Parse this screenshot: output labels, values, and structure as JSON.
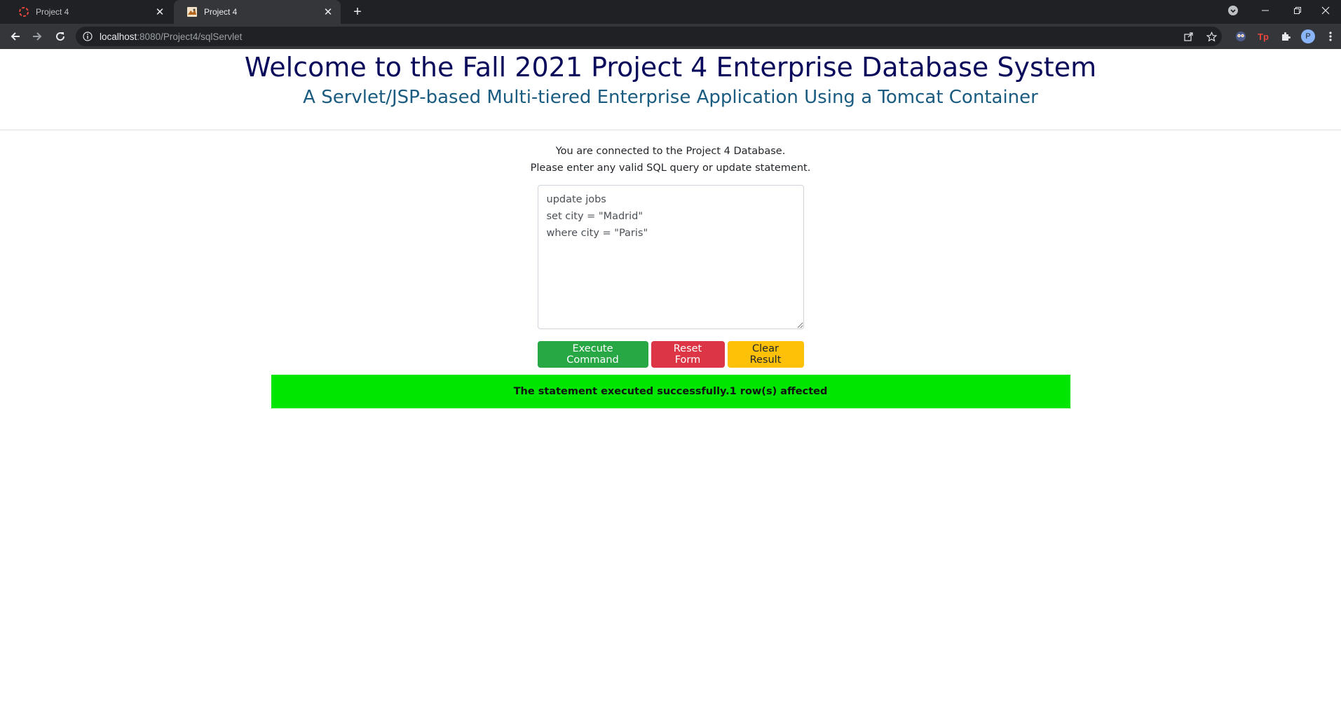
{
  "browser": {
    "tabs": [
      {
        "title": "Project 4",
        "active": false
      },
      {
        "title": "Project 4",
        "active": true
      }
    ],
    "url": {
      "host": "localhost",
      "path": ":8080/Project4/sqlServlet"
    },
    "profile_initial": "P",
    "extension_label": "Tp"
  },
  "page": {
    "title": "Welcome to the Fall 2021 Project 4 Enterprise Database System",
    "subtitle": "A Servlet/JSP-based Multi-tiered Enterprise Application Using a Tomcat Container",
    "intro_line1": "You are connected to the Project 4 Database.",
    "intro_line2": "Please enter any valid SQL query or update statement.",
    "query": "update jobs\nset city = \"Madrid\"\nwhere city = \"Paris\"",
    "buttons": {
      "execute": "Execute Command",
      "reset": "Reset Form",
      "clear": "Clear Result"
    },
    "result_message": "The statement executed successfully.1 row(s) affected",
    "colors": {
      "title": "#0a0a5c",
      "subtitle": "#1a5b80",
      "success": "#28a745",
      "danger": "#dc3545",
      "warning": "#ffc107",
      "result_bg": "#00e600"
    }
  }
}
